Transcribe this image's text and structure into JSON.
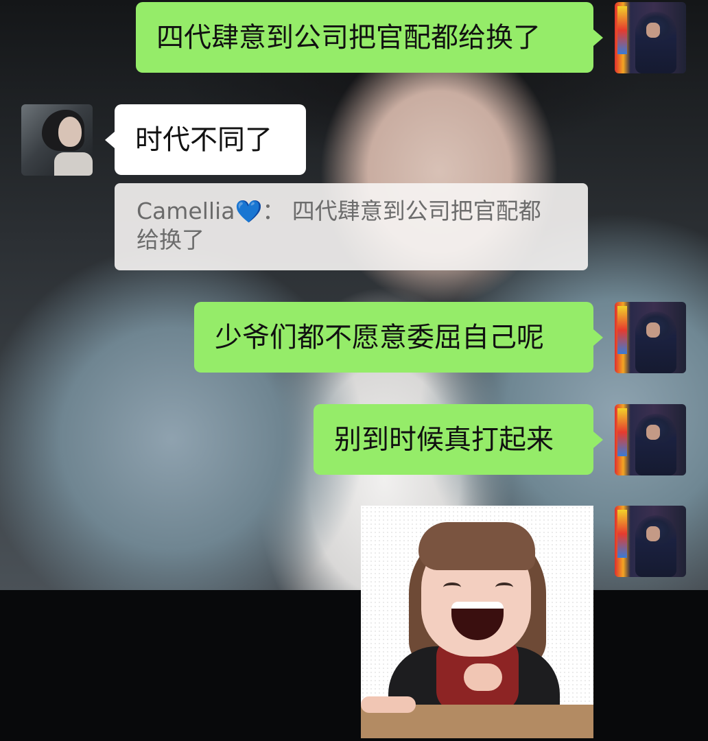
{
  "messages": [
    {
      "side": "right",
      "text": "四代肆意到公司把官配都给换了"
    },
    {
      "side": "left",
      "text": "时代不同了"
    },
    {
      "side": "right",
      "text": "少爷们都不愿意委屈自己呢"
    },
    {
      "side": "right",
      "text": "别到时候真打起来"
    }
  ],
  "quote": {
    "sender": "Camellia",
    "heart": "💙",
    "separator": "：",
    "line1": "四代肆意到公司把官配都",
    "line2": "给换了"
  },
  "sticker": {
    "icon": "laughing-memoji-sticker"
  },
  "colors": {
    "outgoing_bubble": "#95ec69",
    "incoming_bubble": "#ffffff"
  }
}
